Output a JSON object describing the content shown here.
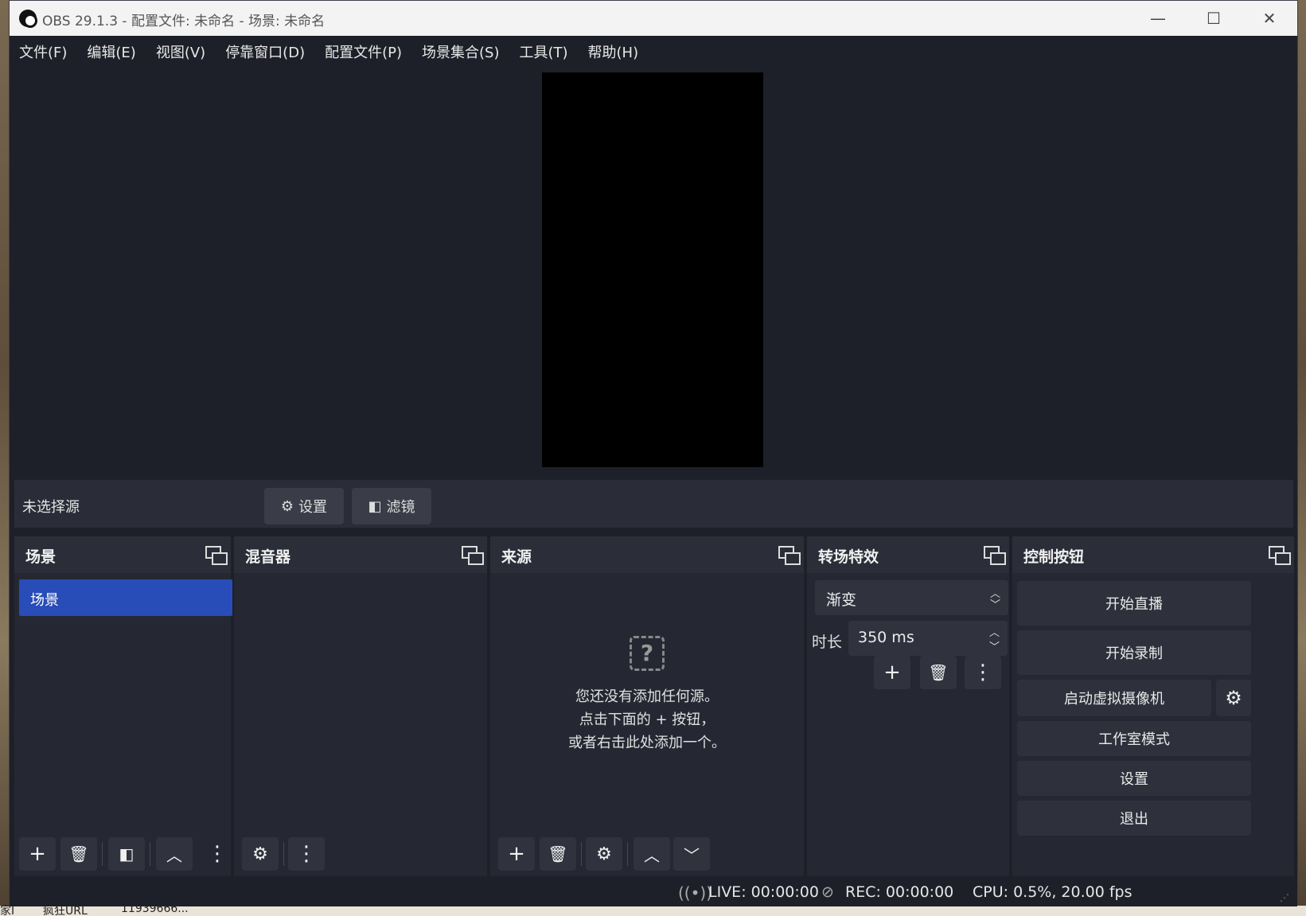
{
  "desktop": {
    "strip_items": [
      "家I",
      "疯狂URL",
      "11939666..."
    ]
  },
  "window": {
    "title": "OBS 29.1.3 - 配置文件: 未命名 - 场景: 未命名",
    "controls": {
      "minimize": "—",
      "maximize": "☐",
      "close": "✕"
    }
  },
  "menu": [
    "文件(F)",
    "编辑(E)",
    "视图(V)",
    "停靠窗口(D)",
    "配置文件(P)",
    "场景集合(S)",
    "工具(T)",
    "帮助(H)"
  ],
  "source_bar": {
    "no_source": "未选择源",
    "settings": "设置",
    "filters": "滤镜"
  },
  "docks": {
    "scenes": {
      "title": "场景",
      "items": [
        "场景"
      ]
    },
    "mixer": {
      "title": "混音器"
    },
    "sources": {
      "title": "来源",
      "empty_line1": "您还没有添加任何源。",
      "empty_line2": "点击下面的 + 按钮，",
      "empty_line3": "或者右击此处添加一个。"
    },
    "transitions": {
      "title": "转场特效",
      "selected": "渐变",
      "duration_label": "时长",
      "duration_value": "350 ms"
    },
    "controls": {
      "title": "控制按钮",
      "start_stream": "开始直播",
      "start_record": "开始录制",
      "virtual_cam": "启动虚拟摄像机",
      "studio_mode": "工作室模式",
      "settings": "设置",
      "exit": "退出"
    }
  },
  "status": {
    "live": "LIVE: 00:00:00",
    "rec": "REC: 00:00:00",
    "cpu": "CPU: 0.5%, 20.00 fps"
  },
  "colors": {
    "window_bg": "#1e2029",
    "dock_bg": "#252833",
    "selected_scene": "#284cb8"
  }
}
